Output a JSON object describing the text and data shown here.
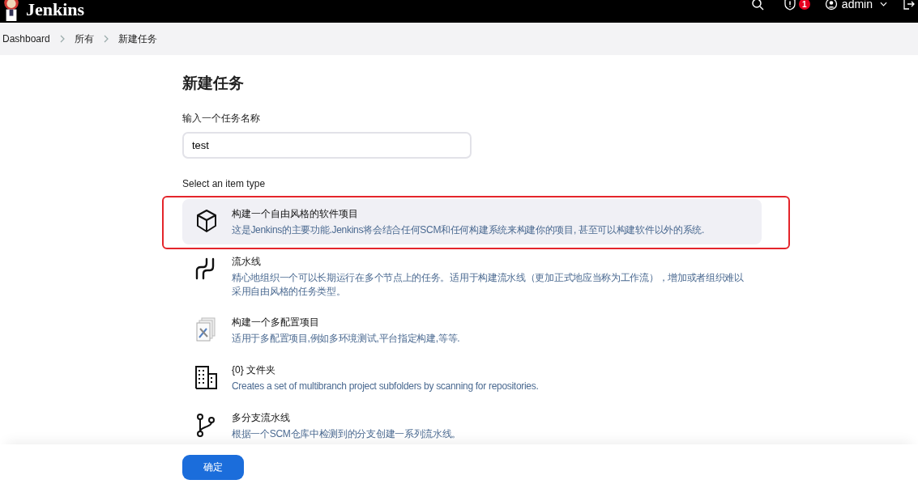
{
  "header": {
    "brand": "Jenkins",
    "alerts": "1",
    "user": "admin"
  },
  "breadcrumb": [
    "Dashboard",
    "所有",
    "新建任务"
  ],
  "page_title": "新建任务",
  "name_field": {
    "label": "输入一个任务名称",
    "value": "test"
  },
  "item_type_label": "Select an item type",
  "items": [
    {
      "kind": "freestyle",
      "title": "构建一个自由风格的软件项目",
      "description": "这是Jenkins的主要功能.Jenkins将会结合任何SCM和任何构建系统来构建你的项目, 甚至可以构建软件以外的系统.",
      "selected": true,
      "highlighted": true
    },
    {
      "kind": "pipeline",
      "title": "流水线",
      "description": "精心地组织一个可以长期运行在多个节点上的任务。适用于构建流水线（更加正式地应当称为工作流），增加或者组织难以采用自由风格的任务类型。",
      "selected": false,
      "highlighted": false
    },
    {
      "kind": "matrix",
      "title": "构建一个多配置项目",
      "description": "适用于多配置项目,例如多环境测试,平台指定构建,等等.",
      "selected": false,
      "highlighted": false
    },
    {
      "kind": "folder",
      "title": "{0} 文件夹",
      "description": "Creates a set of multibranch project subfolders by scanning for repositories.",
      "selected": false,
      "highlighted": false
    },
    {
      "kind": "multibranch",
      "title": "多分支流水线",
      "description": "根据一个SCM仓库中检测到的分支创建一系列流水线。",
      "selected": false,
      "highlighted": false
    }
  ],
  "ok_button": "确定"
}
